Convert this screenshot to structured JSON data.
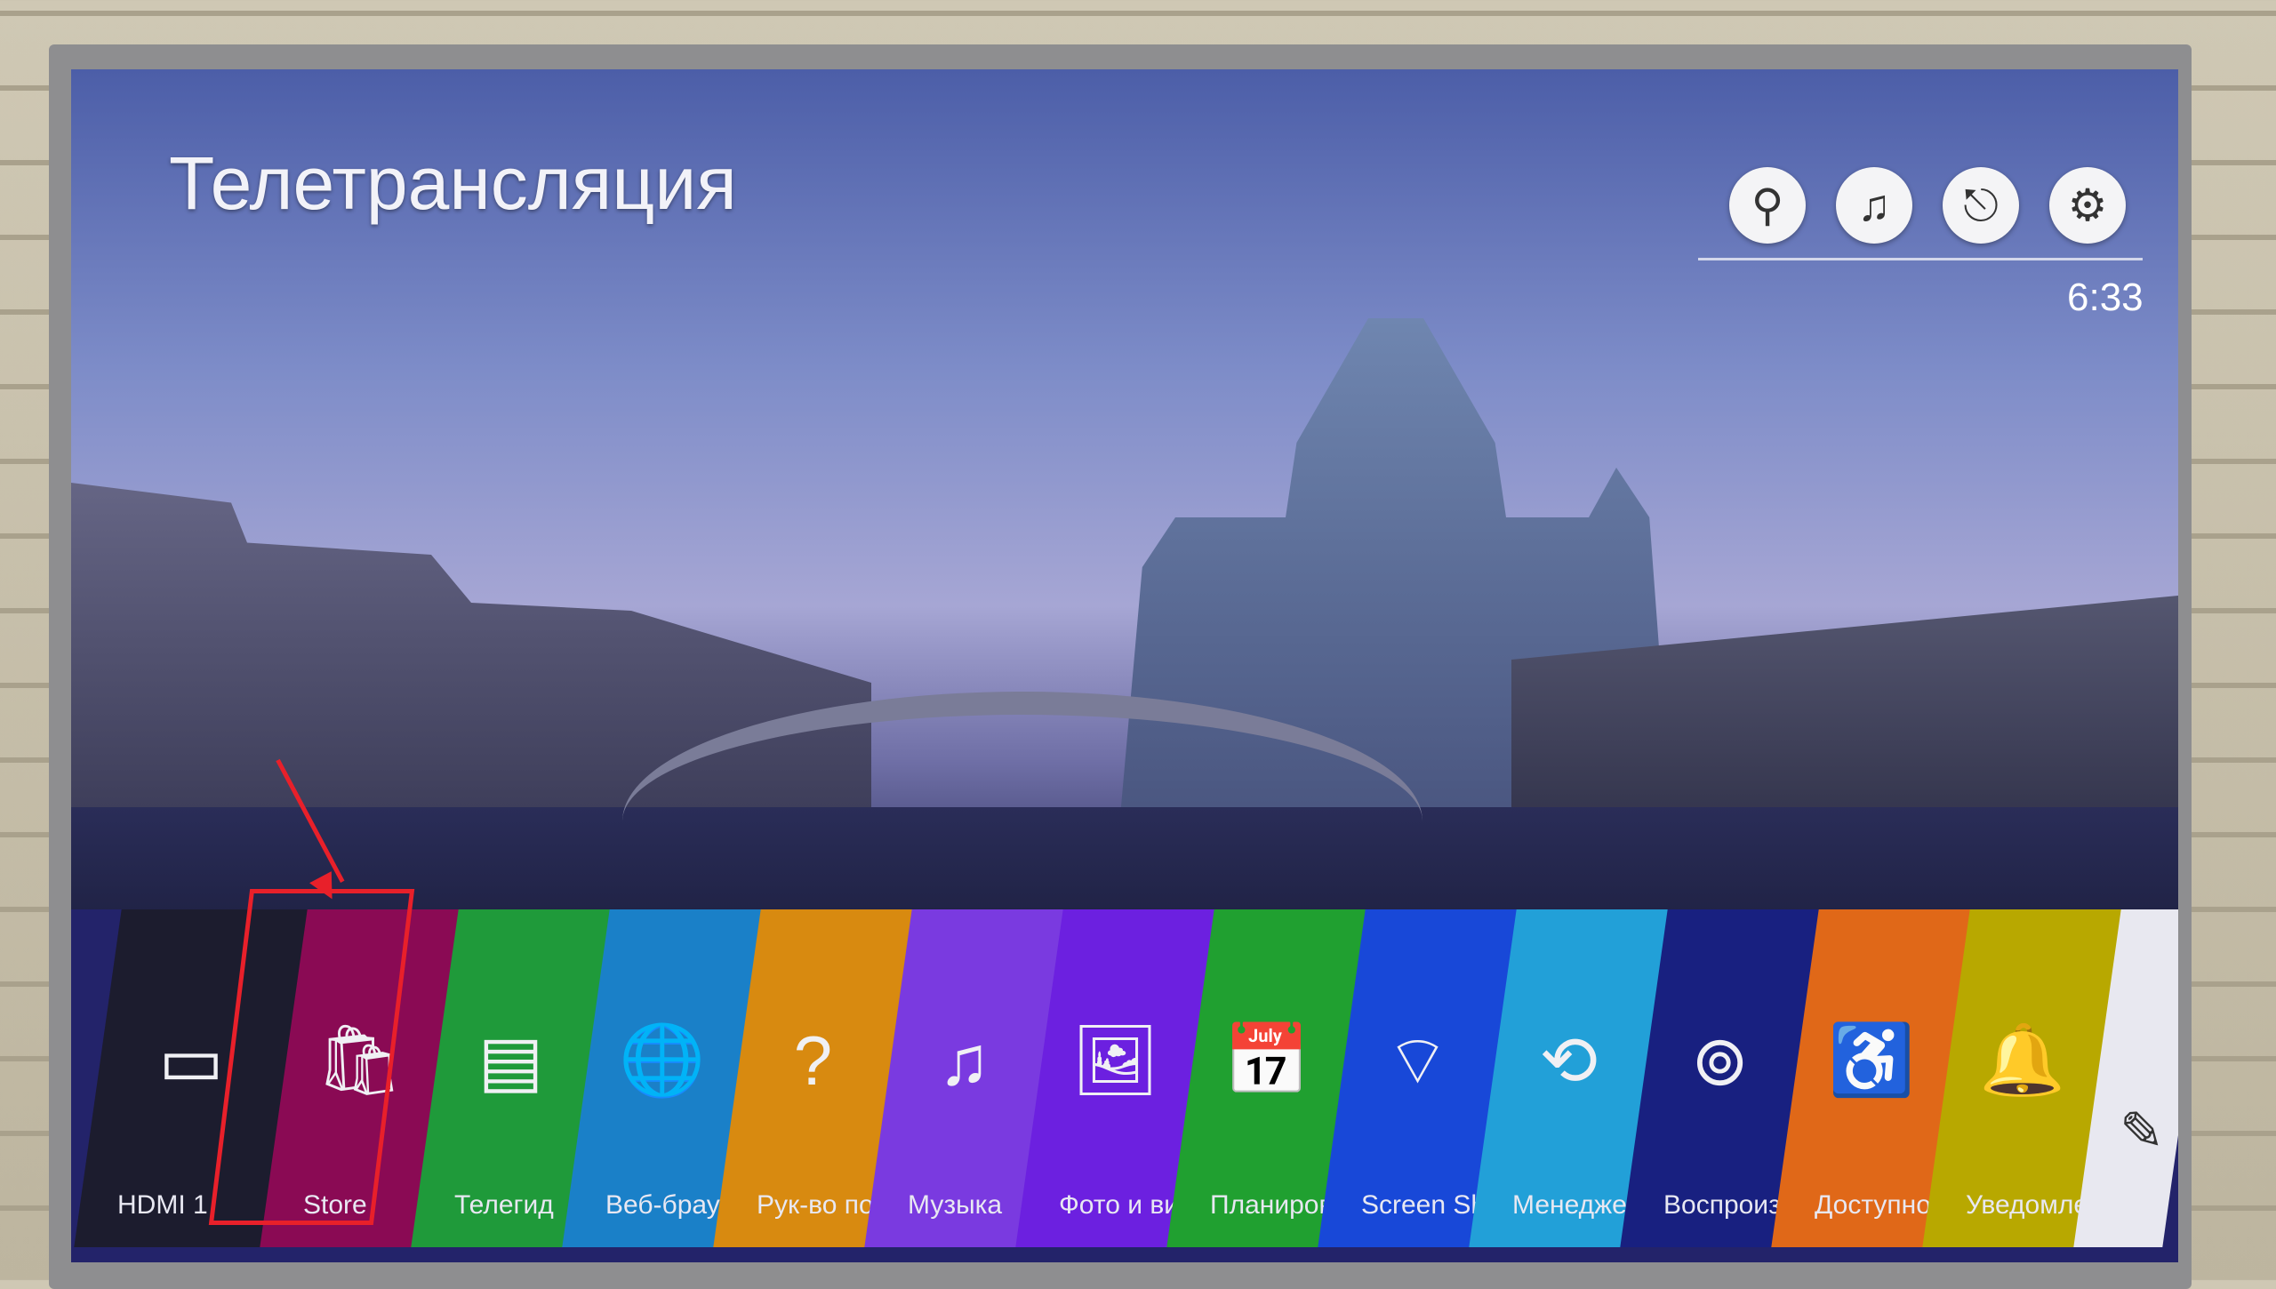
{
  "header": {
    "title": "Телетрансляция",
    "time": "6:33",
    "icons": [
      "search-icon",
      "music-icon",
      "input-icon",
      "settings-icon"
    ]
  },
  "launcher": {
    "items": [
      {
        "label": "HDMI 1",
        "icon": "hdmi-icon",
        "color": "#1c1c2e"
      },
      {
        "label": "Store",
        "icon": "store-bag-icon",
        "color": "#8a0a54"
      },
      {
        "label": "Телегид",
        "icon": "tv-guide-icon",
        "color": "#1f9a3a"
      },
      {
        "label": "Веб-браузер",
        "icon": "globe-icon",
        "color": "#1a80c8"
      },
      {
        "label": "Рук-во пол",
        "icon": "help-icon",
        "color": "#d88a10"
      },
      {
        "label": "Музыка",
        "icon": "music-note-icon",
        "color": "#7a3ae0"
      },
      {
        "label": "Фото и вид",
        "icon": "photo-icon",
        "color": "#6c20e0"
      },
      {
        "label": "Планировщ",
        "icon": "scheduler-icon",
        "color": "#20a030"
      },
      {
        "label": "Screen Sha",
        "icon": "screen-share-icon",
        "color": "#1848d8"
      },
      {
        "label": "Менеджер",
        "icon": "connection-manager-icon",
        "color": "#22a0d8"
      },
      {
        "label": "Воспроизв",
        "icon": "bluetooth-speaker-icon",
        "color": "#182080"
      },
      {
        "label": "Доступнос",
        "icon": "accessibility-icon",
        "color": "#e06818"
      },
      {
        "label": "Уведомле",
        "icon": "notification-bell-icon",
        "color": "#b8a800"
      },
      {
        "label": "",
        "icon": "edit-pencil-icon",
        "color": "#e8e8f0"
      }
    ]
  },
  "annotation": {
    "highlight_color": "#e8202a"
  }
}
